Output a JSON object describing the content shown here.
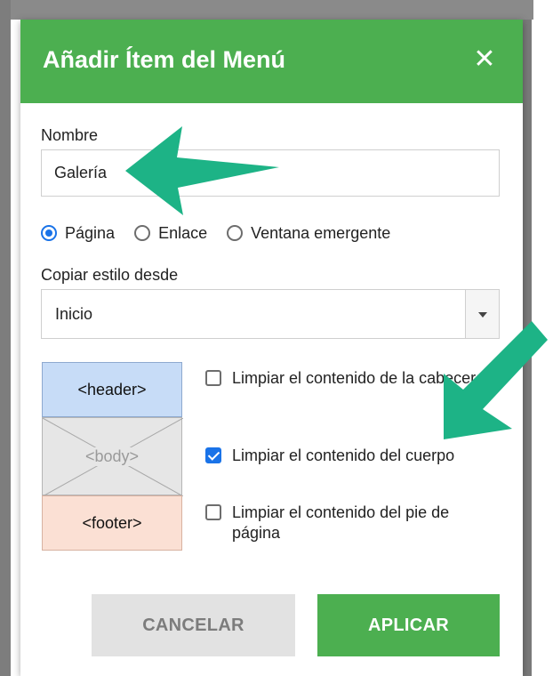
{
  "dialog": {
    "title": "Añadir Ítem del Menú",
    "close_glyph": "✕"
  },
  "name_field": {
    "label": "Nombre",
    "value": "Galería"
  },
  "link_type": {
    "options": [
      "Página",
      "Enlace",
      "Ventana emergente"
    ],
    "selected": "Página"
  },
  "copy_style": {
    "label": "Copiar estilo desde",
    "selected": "Inicio"
  },
  "layout_preview": {
    "header": "<header>",
    "body": "<body>",
    "footer": "<footer>"
  },
  "clear_options": [
    {
      "label": "Limpiar el contenido de la cabecera",
      "checked": false
    },
    {
      "label": "Limpiar el contenido del cuerpo",
      "checked": true
    },
    {
      "label": "Limpiar el contenido del pie de página",
      "checked": false
    }
  ],
  "buttons": {
    "cancel": "CANCELAR",
    "apply": "APLICAR"
  },
  "annotations": {
    "arrow_color": "#1db386"
  },
  "colors": {
    "accent_green": "#4caf50",
    "checkbox_blue": "#1a73e8"
  },
  "icons": [
    "close-icon",
    "chevron-down-icon",
    "arrow-annotation"
  ]
}
